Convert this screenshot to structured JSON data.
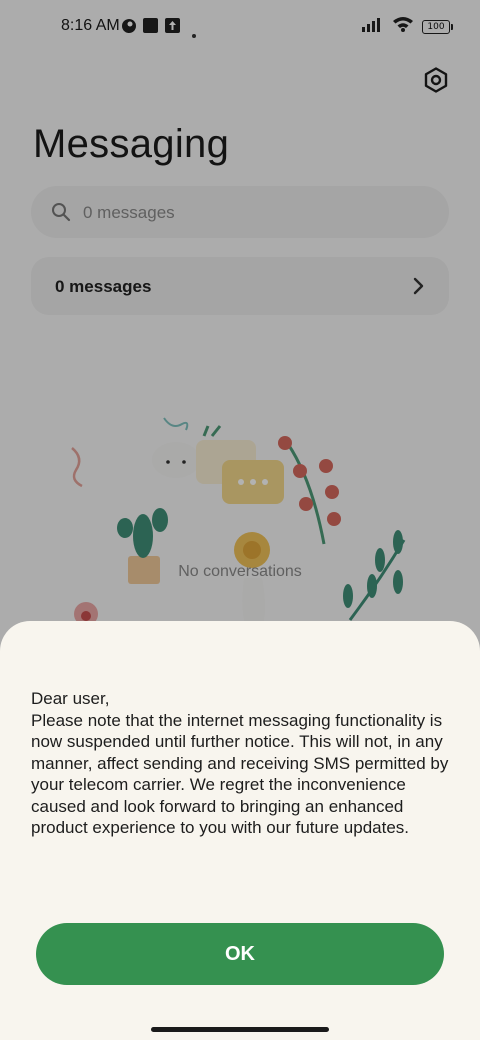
{
  "status_bar": {
    "time": "8:16 AM",
    "battery": "100",
    "icons": [
      "cloud-app-icon",
      "square-notification-icon",
      "upload-notification-icon",
      "dot-icon",
      "signal-icon",
      "wifi-icon",
      "battery-icon"
    ]
  },
  "header": {
    "title": "Messaging",
    "settings_icon": "gear-icon"
  },
  "search": {
    "placeholder": "0 messages"
  },
  "messages_row": {
    "label": "0 messages",
    "chevron_icon": "chevron-right-icon"
  },
  "empty_state": {
    "text": "No conversations"
  },
  "dialog": {
    "greeting": "Dear user,",
    "body": "Please note that the internet messaging functionality is now suspended until further notice. This will not, in any manner, affect sending and receiving SMS permitted by your telecom carrier. We regret the inconvenience caused and look forward to bringing an enhanced product experience to you with our future updates.",
    "ok_label": "OK"
  },
  "colors": {
    "accent": "#359150",
    "sheet_background": "#f8f5ee"
  }
}
